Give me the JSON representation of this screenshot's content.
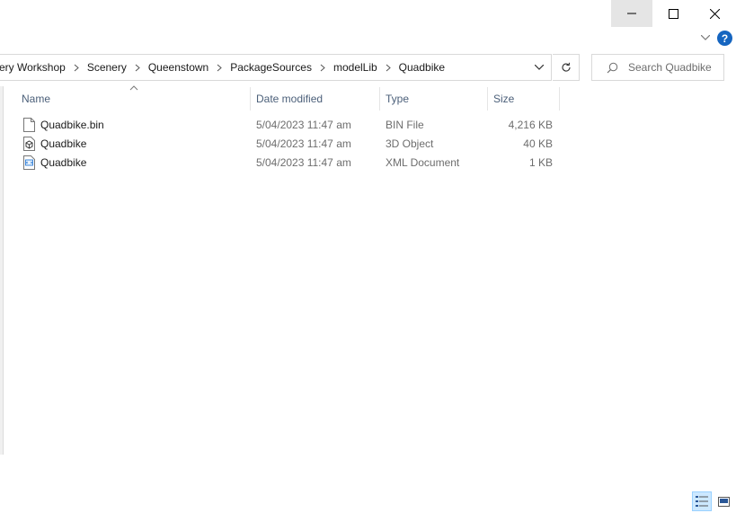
{
  "window": {
    "minimize_icon": "minimize-icon",
    "maximize_icon": "maximize-icon",
    "close_icon": "close-icon",
    "help_label": "?"
  },
  "address_bar": {
    "breadcrumbs": [
      "ery Workshop",
      "Scenery",
      "Queenstown",
      "PackageSources",
      "modelLib",
      "Quadbike"
    ]
  },
  "search": {
    "placeholder": "Search Quadbike"
  },
  "columns": {
    "name": "Name",
    "date_modified": "Date modified",
    "type": "Type",
    "size": "Size"
  },
  "files": [
    {
      "name": "Quadbike.bin",
      "date": "5/04/2023 11:47 am",
      "type": "BIN File",
      "size": "4,216 KB",
      "icon": "blank-file-icon"
    },
    {
      "name": "Quadbike",
      "date": "5/04/2023 11:47 am",
      "type": "3D Object",
      "size": "40 KB",
      "icon": "3d-object-icon"
    },
    {
      "name": "Quadbike",
      "date": "5/04/2023 11:47 am",
      "type": "XML Document",
      "size": "1 KB",
      "icon": "xml-file-icon"
    }
  ],
  "colors": {
    "header_text": "#4c607a",
    "accent": "#1565c0",
    "selected_view": "#cce8ff"
  }
}
